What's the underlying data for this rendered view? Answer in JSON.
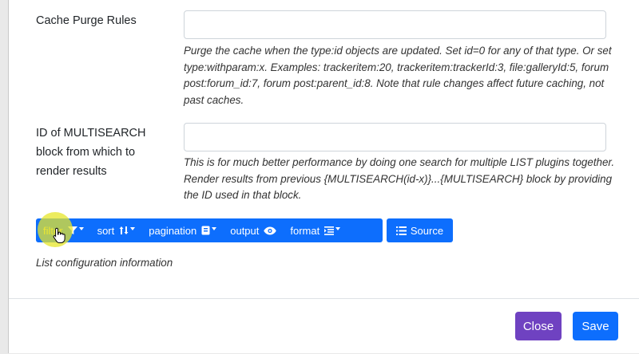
{
  "fields": {
    "cache_purge": {
      "label": "Cache Purge Rules",
      "value": "",
      "help": "Purge the cache when the type:id objects are updated. Set id=0 for any of that type. Or set type:withparam:x. Examples: trackeritem:20, trackeritem:trackerId:3, file:galleryId:5, forum post:forum_id:7, forum post:parent_id:8. Note that rule changes affect future caching, not past caches."
    },
    "multisearch": {
      "label": "ID of MULTISEARCH block from which to render results",
      "value": "",
      "help": "This is for much better performance by doing one search for multiple LIST plugins together. Render results from previous {MULTISEARCH(id-x)}...{MULTISEARCH} block by providing the ID used in that block."
    }
  },
  "toolbar": {
    "filter": "filter",
    "sort": "sort",
    "pagination": "pagination",
    "output": "output",
    "format": "format",
    "source": "Source"
  },
  "info_text": "List configuration information",
  "footer": {
    "close_label": "Close",
    "save_label": "Save"
  },
  "colors": {
    "primary": "#0d6efd",
    "close": "#6f42c1",
    "highlight": "#e6e628"
  }
}
